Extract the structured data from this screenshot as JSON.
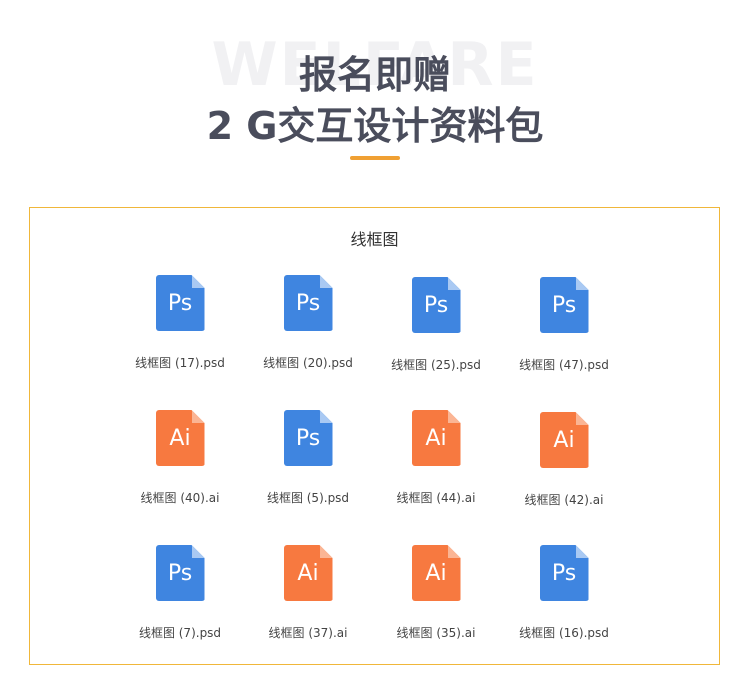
{
  "header": {
    "watermark": "WELFARE",
    "title_line1": "报名即赠",
    "title_line2": "2 G交互设计资料包"
  },
  "panel": {
    "title": "线框图",
    "files": [
      {
        "name": "线框图 (17).psd",
        "type": "ps",
        "glyph": "Ps"
      },
      {
        "name": "线框图 (20).psd",
        "type": "ps",
        "glyph": "Ps"
      },
      {
        "name": "线框图 (25).psd",
        "type": "ps",
        "glyph": "Ps"
      },
      {
        "name": "线框图 (47).psd",
        "type": "ps",
        "glyph": "Ps"
      },
      {
        "name": "线框图 (40).ai",
        "type": "ai",
        "glyph": "Ai"
      },
      {
        "name": "线框图 (5).psd",
        "type": "ps",
        "glyph": "Ps"
      },
      {
        "name": "线框图 (44).ai",
        "type": "ai",
        "glyph": "Ai"
      },
      {
        "name": "线框图 (42).ai",
        "type": "ai",
        "glyph": "Ai"
      },
      {
        "name": "线框图 (7).psd",
        "type": "ps",
        "glyph": "Ps"
      },
      {
        "name": "线框图 (37).ai",
        "type": "ai",
        "glyph": "Ai"
      },
      {
        "name": "线框图 (35).ai",
        "type": "ai",
        "glyph": "Ai"
      },
      {
        "name": "线框图 (16).psd",
        "type": "ps",
        "glyph": "Ps"
      }
    ]
  },
  "colors": {
    "ps_icon": "#3f85e0",
    "ai_icon": "#f77940",
    "accent": "#f0a033",
    "border": "#f0b73a",
    "title_text": "#4a4d5c"
  }
}
